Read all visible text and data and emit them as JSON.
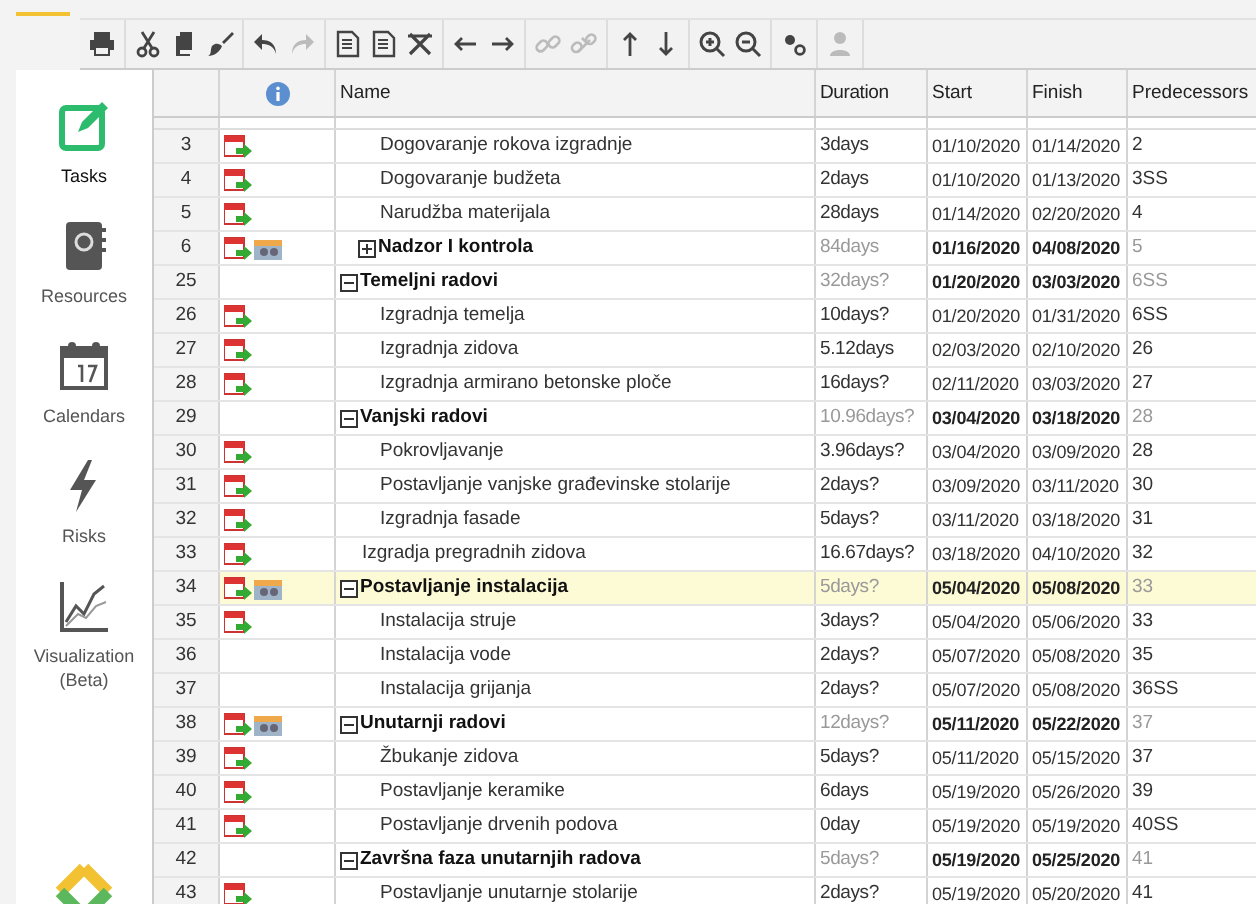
{
  "toolbar": [
    [
      {
        "disabled": false
      }
    ],
    [
      {
        "disabled": false
      },
      {
        "disabled": false
      },
      {
        "disabled": false
      }
    ],
    [
      {
        "disabled": false
      },
      {
        "disabled": true
      }
    ],
    [
      {
        "disabled": false
      },
      {
        "disabled": false
      },
      {
        "disabled": false
      }
    ],
    [
      {
        "disabled": false
      },
      {
        "disabled": false
      }
    ],
    [
      {
        "disabled": true
      },
      {
        "disabled": true
      }
    ],
    [
      {
        "disabled": false
      },
      {
        "disabled": false
      }
    ],
    [
      {
        "disabled": false
      },
      {
        "disabled": false
      }
    ],
    [
      {
        "disabled": false
      }
    ],
    [
      {
        "disabled": true
      }
    ]
  ],
  "sidebar": {
    "items": [
      {
        "label": "Tasks",
        "selected": true
      },
      {
        "label": "Resources",
        "selected": false
      },
      {
        "label": "Calendars",
        "selected": false
      },
      {
        "label": "Risks",
        "selected": false
      },
      {
        "label": "Visualization (Beta)",
        "selected": false
      }
    ]
  },
  "table": {
    "columns": [
      "Name",
      "Duration",
      "Start",
      "Finish",
      "Predecessors"
    ],
    "rows": [
      {
        "children": [
          {
            "id": "3",
            "kind": "task",
            "calendar_icon": true,
            "resource_icon": false,
            "name": "Dogovaranje rokova izgradnje",
            "duration": "3days",
            "start": "01/10/2020",
            "finish": "01/14/2020",
            "predecessors": "2",
            "selected": false
          },
          {
            "id": "4",
            "kind": "task",
            "calendar_icon": true,
            "resource_icon": false,
            "name": "Dogovaranje budžeta",
            "duration": "2days",
            "start": "01/10/2020",
            "finish": "01/13/2020",
            "predecessors": "3SS",
            "selected": false
          },
          {
            "id": "5",
            "kind": "task",
            "calendar_icon": true,
            "resource_icon": false,
            "name": "Narudžba materijala",
            "duration": "28days",
            "start": "01/14/2020",
            "finish": "02/20/2020",
            "predecessors": "4",
            "selected": false
          },
          {
            "id": "6",
            "kind": "summary",
            "expanded": false,
            "calendar_icon": true,
            "resource_icon": true,
            "name": "Nadzor I kontrola",
            "duration": "84days",
            "start": "01/16/2020",
            "finish": "04/08/2020",
            "predecessors": "5",
            "selected": false
          }
        ]
      },
      {
        "id": "25",
        "kind": "summary",
        "expanded": true,
        "calendar_icon": false,
        "resource_icon": false,
        "name": "Temeljni radovi",
        "duration": "32days?",
        "start": "01/20/2020",
        "finish": "03/03/2020",
        "predecessors": "6SS",
        "selected": false,
        "children": [
          {
            "id": "26",
            "kind": "task",
            "calendar_icon": true,
            "resource_icon": false,
            "name": "Izgradnja temelja",
            "duration": "10days?",
            "start": "01/20/2020",
            "finish": "01/31/2020",
            "predecessors": "6SS",
            "selected": false
          },
          {
            "id": "27",
            "kind": "task",
            "calendar_icon": true,
            "resource_icon": false,
            "name": "Izgradnja zidova",
            "duration": "5.12days",
            "start": "02/03/2020",
            "finish": "02/10/2020",
            "predecessors": "26",
            "selected": false
          },
          {
            "id": "28",
            "kind": "task",
            "calendar_icon": true,
            "resource_icon": false,
            "name": "Izgradnja armirano betonske ploče",
            "duration": "16days?",
            "start": "02/11/2020",
            "finish": "03/03/2020",
            "predecessors": "27",
            "selected": false
          }
        ]
      },
      {
        "id": "29",
        "kind": "summary",
        "expanded": true,
        "calendar_icon": false,
        "resource_icon": false,
        "name": "Vanjski radovi",
        "duration": "10.96days?",
        "start": "03/04/2020",
        "finish": "03/18/2020",
        "predecessors": "28",
        "selected": false,
        "children": [
          {
            "id": "30",
            "kind": "task",
            "calendar_icon": true,
            "resource_icon": false,
            "name": "Pokrovljavanje",
            "duration": "3.96days?",
            "start": "03/04/2020",
            "finish": "03/09/2020",
            "predecessors": "28",
            "selected": false
          },
          {
            "id": "31",
            "kind": "task",
            "calendar_icon": true,
            "resource_icon": false,
            "name": "Postavljanje vanjske građevinske stolarije",
            "duration": "2days?",
            "start": "03/09/2020",
            "finish": "03/11/2020",
            "predecessors": "30",
            "selected": false
          },
          {
            "id": "32",
            "kind": "task",
            "calendar_icon": true,
            "resource_icon": false,
            "name": "Izgradnja fasade",
            "duration": "5days?",
            "start": "03/11/2020",
            "finish": "03/18/2020",
            "predecessors": "31",
            "selected": false
          }
        ]
      },
      {
        "id": "33",
        "kind": "task",
        "calendar_icon": true,
        "resource_icon": false,
        "name": "Izgradja pregradnih zidova",
        "duration": "16.67days?",
        "start": "03/18/2020",
        "finish": "04/10/2020",
        "predecessors": "32",
        "selected": false
      },
      {
        "id": "34",
        "kind": "summary",
        "expanded": true,
        "calendar_icon": true,
        "resource_icon": true,
        "name": "Postavljanje instalacija",
        "duration": "5days?",
        "start": "05/04/2020",
        "finish": "05/08/2020",
        "predecessors": "33",
        "selected": true,
        "children": [
          {
            "id": "35",
            "kind": "task",
            "calendar_icon": true,
            "resource_icon": false,
            "name": "Instalacija struje",
            "duration": "3days?",
            "start": "05/04/2020",
            "finish": "05/06/2020",
            "predecessors": "33",
            "selected": false
          },
          {
            "id": "36",
            "kind": "task",
            "calendar_icon": false,
            "resource_icon": false,
            "name": "Instalacija vode",
            "duration": "2days?",
            "start": "05/07/2020",
            "finish": "05/08/2020",
            "predecessors": "35",
            "selected": false
          },
          {
            "id": "37",
            "kind": "task",
            "calendar_icon": false,
            "resource_icon": false,
            "name": "Instalacija grijanja",
            "duration": "2days?",
            "start": "05/07/2020",
            "finish": "05/08/2020",
            "predecessors": "36SS",
            "selected": false
          }
        ]
      },
      {
        "id": "38",
        "kind": "summary",
        "expanded": true,
        "calendar_icon": true,
        "resource_icon": true,
        "name": "Unutarnji radovi",
        "duration": "12days?",
        "start": "05/11/2020",
        "finish": "05/22/2020",
        "predecessors": "37",
        "selected": false,
        "children": [
          {
            "id": "39",
            "kind": "task",
            "calendar_icon": true,
            "resource_icon": false,
            "name": "Žbukanje zidova",
            "duration": "5days?",
            "start": "05/11/2020",
            "finish": "05/15/2020",
            "predecessors": "37",
            "selected": false
          },
          {
            "id": "40",
            "kind": "task",
            "calendar_icon": true,
            "resource_icon": false,
            "name": "Postavljanje keramike",
            "duration": "6days",
            "start": "05/19/2020",
            "finish": "05/26/2020",
            "predecessors": "39",
            "selected": false
          },
          {
            "id": "41",
            "kind": "task",
            "calendar_icon": true,
            "resource_icon": false,
            "name": "Postavljanje drvenih podova",
            "duration": "0day",
            "start": "05/19/2020",
            "finish": "05/19/2020",
            "predecessors": "40SS",
            "selected": false
          }
        ]
      },
      {
        "id": "42",
        "kind": "summary",
        "expanded": true,
        "calendar_icon": false,
        "resource_icon": false,
        "name": "Završna faza unutarnjih radova",
        "duration": "5days?",
        "start": "05/19/2020",
        "finish": "05/25/2020",
        "predecessors": "41",
        "selected": false,
        "children": [
          {
            "id": "43",
            "kind": "task",
            "calendar_icon": true,
            "resource_icon": false,
            "name": "Postavljanje unutarnje stolarije",
            "duration": "2days?",
            "start": "05/19/2020",
            "finish": "05/20/2020",
            "predecessors": "41",
            "selected": false
          }
        ]
      }
    ]
  }
}
